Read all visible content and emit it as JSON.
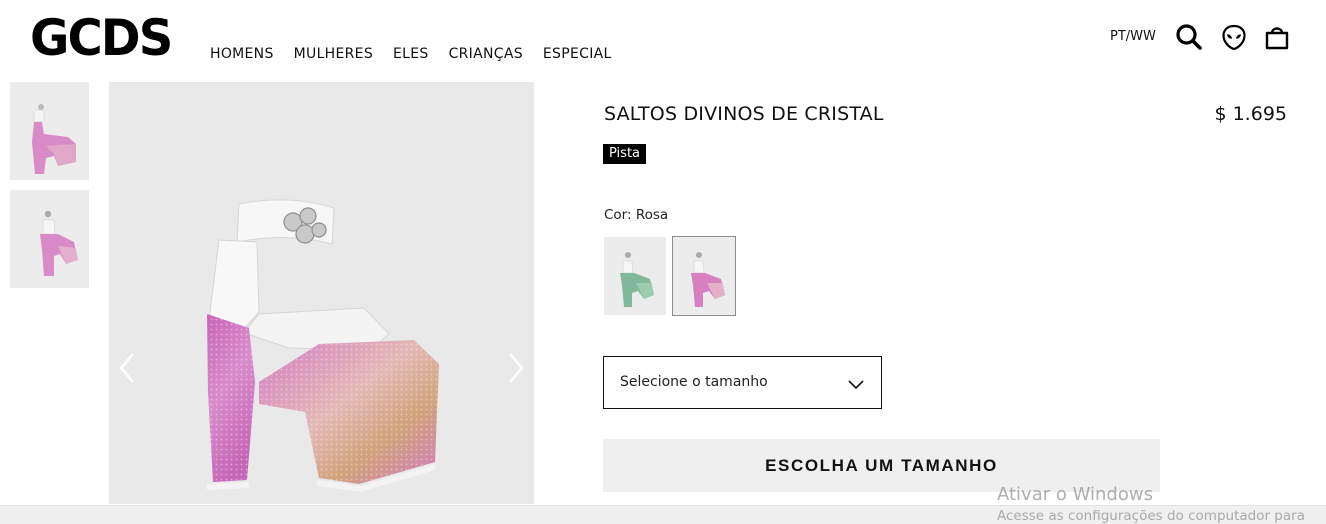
{
  "brand": {
    "logo": "GCDS"
  },
  "nav": {
    "items": [
      {
        "label": "HOMENS"
      },
      {
        "label": "MULHERES"
      },
      {
        "label": "ELES"
      },
      {
        "label": "CRIANÇAS"
      },
      {
        "label": "ESPECIAL"
      }
    ]
  },
  "header": {
    "locale": "PT/WW",
    "icons": [
      "search-icon",
      "alien-account-icon",
      "shopping-bag-icon"
    ]
  },
  "gallery": {
    "thumbnails": [
      "thumbnail-side-view",
      "thumbnail-front-view"
    ],
    "main_image": "pink-crystal-platform-heel",
    "arrows": [
      "chevron-left-icon",
      "chevron-right-icon"
    ]
  },
  "product": {
    "title": "SALTOS DIVINOS DE CRISTAL",
    "price": "$ 1.695",
    "badge": "Pista",
    "color_label": "Cor: Rosa",
    "swatches": [
      {
        "name": "Verde",
        "selected": false
      },
      {
        "name": "Rosa",
        "selected": true
      }
    ],
    "size_placeholder": "Selecione o tamanho",
    "cta_label": "ESCOLHA UM TAMANHO"
  },
  "watermark": {
    "title": "Ativar o Windows",
    "subtitle": "Acesse as configurações do computador para"
  },
  "colors": {
    "pink_crystal": "#d77fc0",
    "green_crystal": "#7fb89a",
    "image_bg": "#e9e9ea",
    "cta_bg": "#efefef"
  }
}
